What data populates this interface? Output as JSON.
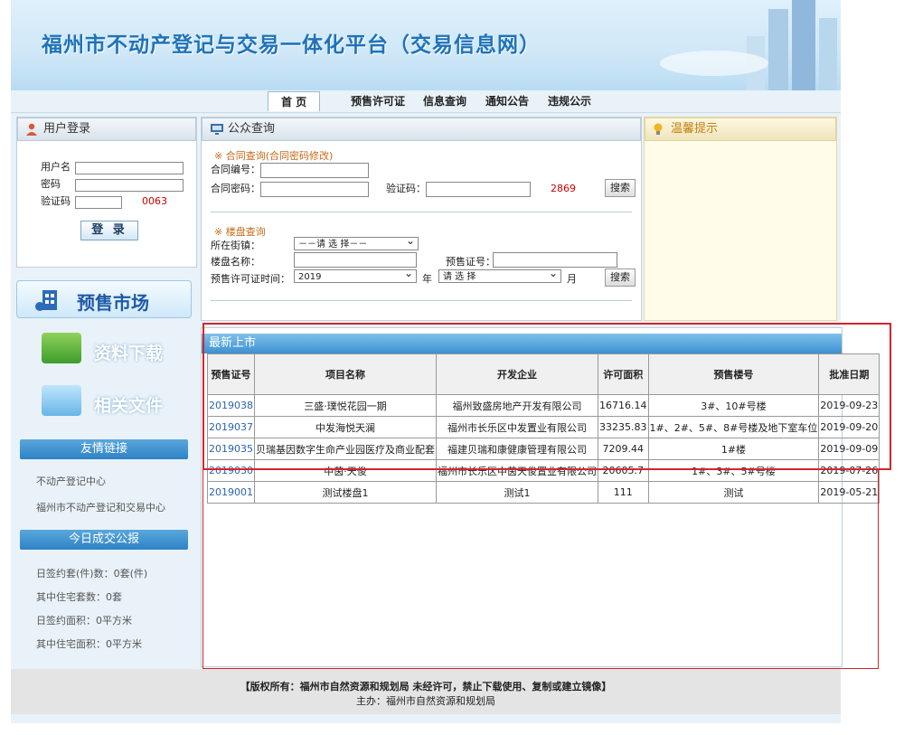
{
  "header": {
    "title": "福州市不动产登记与交易一体化平台（交易信息网）"
  },
  "nav": {
    "items": [
      "首 页",
      "预售许可证",
      "信息查询",
      "通知公告",
      "违规公示"
    ]
  },
  "login": {
    "title": "用户登录",
    "username_label": "用户名",
    "password_label": "密码",
    "captcha_label": "验证码",
    "captcha_code": "0063",
    "submit": "登 录"
  },
  "sidebar": {
    "presale_market": "预售市场",
    "downloads": "资料下载",
    "related_docs": "相关文件",
    "friend_links_title": "友情链接",
    "links": [
      "不动产登记中心",
      "福州市不动产登记和交易中心"
    ],
    "daily_title": "今日成交公报",
    "daily_stats": [
      "日签约套(件)数：0套(件)",
      "其中住宅套数：0套",
      "日签约面积：0平方米",
      "其中住宅面积：0平方米"
    ]
  },
  "query": {
    "title": "公众查询",
    "contract_section": "※ 合同查询(合同密码修改)",
    "contract_no_label": "合同编号：",
    "contract_pwd_label": "合同密码：",
    "captcha_label": "验证码：",
    "captcha_code": "2869",
    "search": "搜索",
    "building_section": "※ 楼盘查询",
    "street_label": "所在街镇：",
    "street_value": "－－请 选 择－－",
    "building_name_label": "楼盘名称：",
    "presale_no_label": "预售证号：",
    "permit_time_label": "预售许可证时间：",
    "year_value": "2019",
    "year_label": "年",
    "month_value": "请 选 择",
    "month_label": "月"
  },
  "tips": {
    "title": "温馨提示"
  },
  "new_listings": {
    "title": "最新上市",
    "columns": [
      "预售证号",
      "项目名称",
      "开发企业",
      "许可面积",
      "预售楼号",
      "批准日期"
    ],
    "rows": [
      [
        "2019038",
        "三盛·璞悦花园一期",
        "福州致盛房地产开发有限公司",
        "16716.14",
        "3#、10#号楼",
        "2019-09-23"
      ],
      [
        "2019037",
        "中发海悦天澜",
        "福州市长乐区中发置业有限公司",
        "33235.83",
        "1#、2#、5#、8#号楼及地下室车位",
        "2019-09-20"
      ],
      [
        "2019035",
        "贝瑞基因数字生命产业园医疗及商业配套",
        "福建贝瑞和康健康管理有限公司",
        "7209.44",
        "1#楼",
        "2019-09-09"
      ],
      [
        "2019030",
        "中茵·天俊",
        "福州市长乐区中茵天俊置业有限公司",
        "20605.7",
        "1#、3#、5#号楼",
        "2019-07-26"
      ],
      [
        "2019001",
        "测试楼盘1",
        "测试1",
        "111",
        "测试",
        "2019-05-21"
      ]
    ]
  },
  "footer": {
    "copyright": "【版权所有：福州市自然资源和规划局 未经许可，禁止下载使用、复制或建立镜像】",
    "host": "主办：福州市自然资源和规划局"
  }
}
